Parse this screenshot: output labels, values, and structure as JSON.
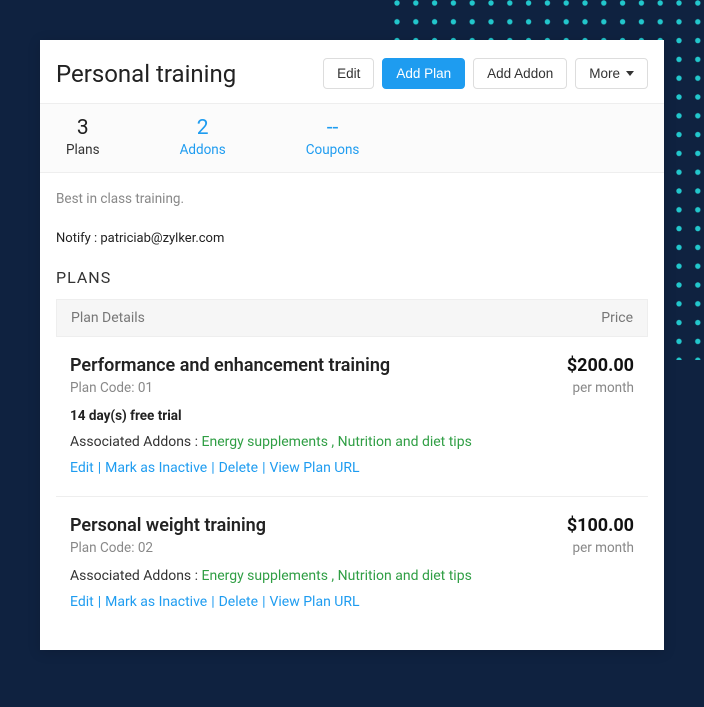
{
  "page": {
    "title": "Personal training",
    "description": "Best in class training.",
    "notify_label": "Notify : ",
    "notify_email": "patriciab@zylker.com",
    "plans_section_title": "PLANS"
  },
  "header_buttons": {
    "edit": "Edit",
    "add_plan": "Add Plan",
    "add_addon": "Add Addon",
    "more": "More"
  },
  "stats": {
    "plans": {
      "value": "3",
      "label": "Plans"
    },
    "addons": {
      "value": "2",
      "label": "Addons"
    },
    "coupons": {
      "value": "--",
      "label": "Coupons"
    }
  },
  "table": {
    "col_details": "Plan Details",
    "col_price": "Price"
  },
  "addons_label": "Associated Addons : ",
  "addons_sep": " , ",
  "action_sep": " | ",
  "plan_actions": {
    "edit": "Edit",
    "mark_inactive": "Mark as Inactive",
    "delete": "Delete",
    "view_url": "View Plan URL"
  },
  "plans": [
    {
      "name": "Performance and enhancement training",
      "code_label": "Plan Code: 01",
      "price": "$200.00",
      "period": "per month",
      "trial": "14 day(s) free trial",
      "addons": [
        "Energy supplements",
        "Nutrition and diet tips"
      ]
    },
    {
      "name": "Personal weight training",
      "code_label": "Plan Code: 02",
      "price": "$100.00",
      "period": "per month",
      "trial": null,
      "addons": [
        "Energy supplements",
        "Nutrition and diet tips"
      ]
    }
  ]
}
